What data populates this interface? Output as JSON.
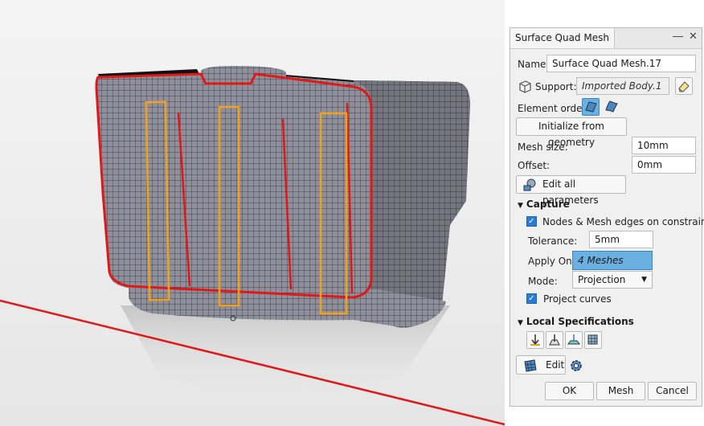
{
  "dialog": {
    "tab_title": "Surface Quad Mesh",
    "pin_icon": "pin-icon",
    "close_icon": "close-icon",
    "name_label": "Name:",
    "name_value": "Surface Quad Mesh.17",
    "support_label": "Support:",
    "support_value": "Imported Body.1",
    "element_order_label": "Element order:",
    "initialize_button": "Initialize from geometry",
    "mesh_size_label": "Mesh size:",
    "mesh_size_value": "10mm",
    "offset_label": "Offset:",
    "offset_value": "0mm",
    "edit_all_button": "Edit all parameters"
  },
  "capture": {
    "section_title": "Capture",
    "nodes_edges_label": "Nodes & Mesh edges on constraints",
    "nodes_edges_checked": true,
    "tolerance_label": "Tolerance:",
    "tolerance_value": "5mm",
    "apply_on_label": "Apply On:",
    "apply_on_value": "4 Meshes",
    "mode_label": "Mode:",
    "mode_value": "Projection",
    "project_curves_label": "Project curves",
    "project_curves_checked": true
  },
  "local_specs": {
    "section_title": "Local Specifications",
    "edit_button": "Edit"
  },
  "footer": {
    "ok": "OK",
    "mesh": "Mesh",
    "cancel": "Cancel"
  },
  "colors": {
    "accent_blue": "#6ab0e0",
    "constraint_red": "#e01818",
    "highlight_orange": "#f0a020",
    "mesh_gray": "#8e8f9a"
  }
}
